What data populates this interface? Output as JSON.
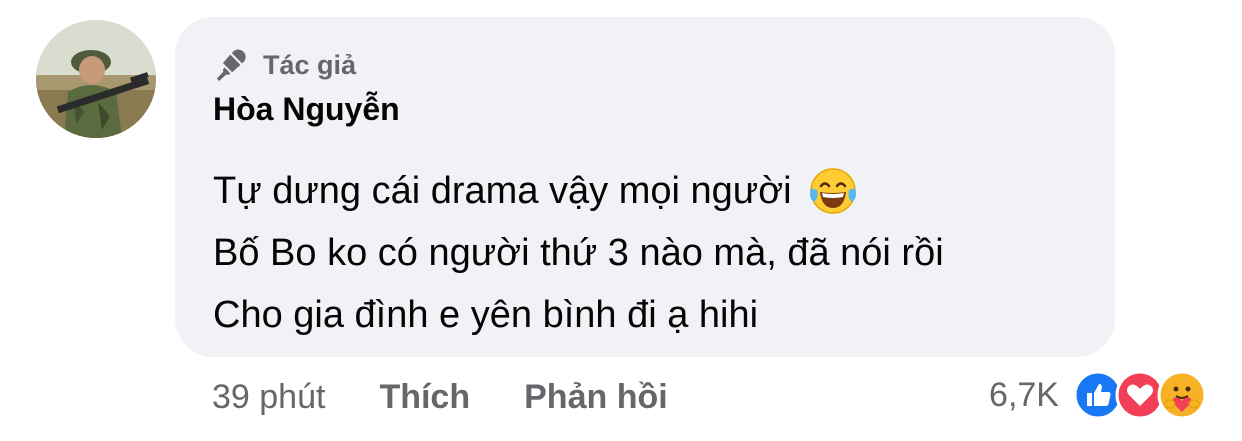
{
  "comment": {
    "author_badge": "Tác giả",
    "author_name": "Hòa Nguyễn",
    "lines": [
      "Tự dưng cái drama vậy mọi người",
      "Bố Bo ko có người thứ 3 nào mà, đã nói rồi",
      "Cho gia đình e yên bình đi ạ hihi"
    ],
    "emoji": "laughing-tears-emoji",
    "time": "39 phút",
    "like_label": "Thích",
    "reply_label": "Phản hồi",
    "reaction_count": "6,7K",
    "reactions": [
      "like-icon",
      "love-icon",
      "care-icon"
    ]
  },
  "colors": {
    "bubble": "#f0f2f5",
    "text": "#050505",
    "muted": "#65676b",
    "like": "#1877f2",
    "love": "#f33e58",
    "care": "#f7b125"
  }
}
